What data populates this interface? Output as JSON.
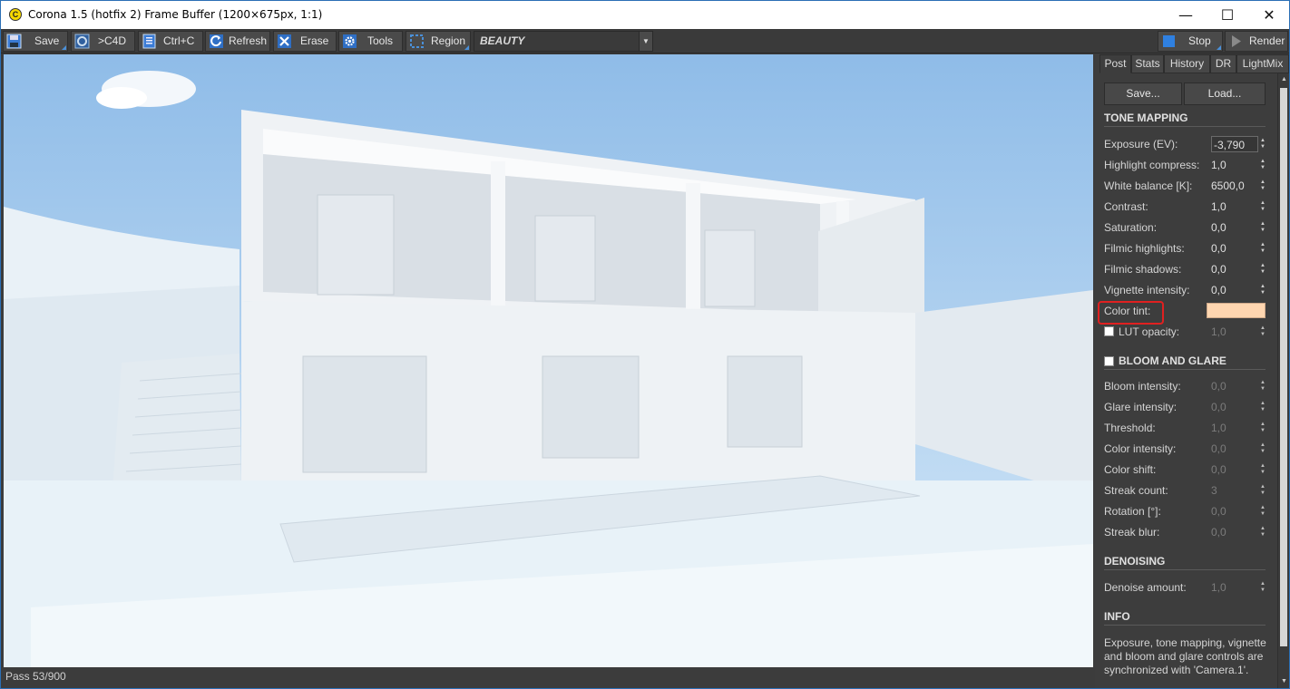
{
  "window": {
    "title": "Corona 1.5 (hotfix 2) Frame Buffer (1200×675px, 1:1)",
    "minimize": "—",
    "maximize": "☐",
    "close": "✕"
  },
  "toolbar": {
    "save": "Save",
    "c4d": ">C4D",
    "copy": "Ctrl+C",
    "refresh": "Refresh",
    "erase": "Erase",
    "tools": "Tools",
    "region": "Region",
    "pass_select": "BEAUTY",
    "stop": "Stop",
    "render": "Render"
  },
  "status": {
    "text": "Pass 53/900"
  },
  "panel": {
    "tabs": [
      "Post",
      "Stats",
      "History",
      "DR",
      "LightMix"
    ],
    "save_btn": "Save...",
    "load_btn": "Load...",
    "tone_mapping": {
      "title": "TONE MAPPING",
      "rows": [
        {
          "label": "Exposure (EV):",
          "value": "-3,790"
        },
        {
          "label": "Highlight compress:",
          "value": "1,0"
        },
        {
          "label": "White balance [K]:",
          "value": "6500,0"
        },
        {
          "label": "Contrast:",
          "value": "1,0"
        },
        {
          "label": "Saturation:",
          "value": "0,0"
        },
        {
          "label": "Filmic highlights:",
          "value": "0,0"
        },
        {
          "label": "Filmic shadows:",
          "value": "0,0"
        },
        {
          "label": "Vignette intensity:",
          "value": "0,0"
        }
      ],
      "color_tint_label": "Color tint:",
      "color_tint_color": "#ffd6b0",
      "lut_label": "LUT opacity:",
      "lut_value": "1,0"
    },
    "bloom": {
      "title": "BLOOM AND GLARE",
      "rows": [
        {
          "label": "Bloom intensity:",
          "value": "0,0"
        },
        {
          "label": "Glare intensity:",
          "value": "0,0"
        },
        {
          "label": "Threshold:",
          "value": "1,0"
        },
        {
          "label": "Color intensity:",
          "value": "0,0"
        },
        {
          "label": "Color shift:",
          "value": "0,0"
        },
        {
          "label": "Streak count:",
          "value": "3"
        },
        {
          "label": "Rotation [°]:",
          "value": "0,0"
        },
        {
          "label": "Streak blur:",
          "value": "0,0"
        }
      ]
    },
    "denoising": {
      "title": "DENOISING",
      "amount_label": "Denoise amount:",
      "amount_value": "1,0"
    },
    "info": {
      "title": "INFO",
      "text": "Exposure, tone mapping, vignette and bloom and glare controls are synchronized with 'Camera.1'."
    }
  },
  "colors": {
    "accent": "#4a90d9",
    "highlight_ring": "#e02020"
  }
}
